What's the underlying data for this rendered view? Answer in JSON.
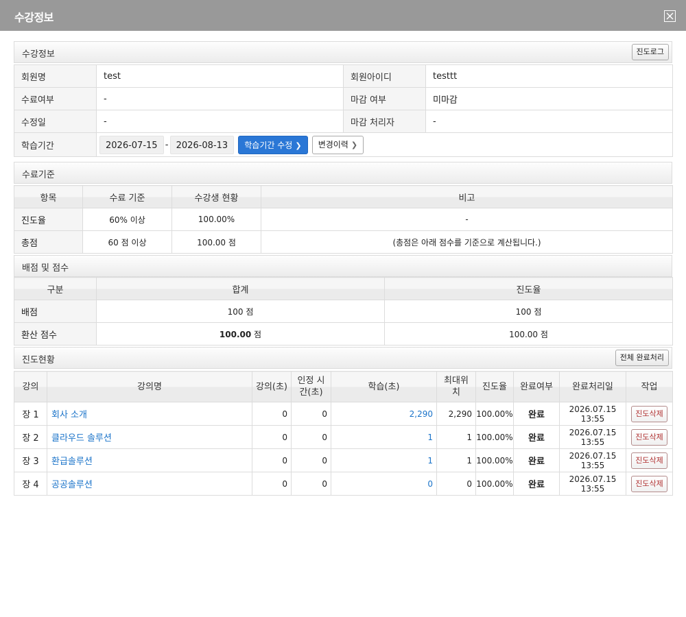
{
  "window": {
    "title": "수강정보"
  },
  "section_info": {
    "title": "수강정보",
    "log_button": "진도로그",
    "rows": {
      "member_name_label": "회원명",
      "member_name": "test",
      "member_id_label": "회원아이디",
      "member_id": "testtt",
      "completion_label": "수료여부",
      "completion": "-",
      "closing_label": "마감 여부",
      "closing": "미마감",
      "modified_label": "수정일",
      "modified": "-",
      "closer_label": "마감 처리자",
      "closer": "-",
      "period_label": "학습기간",
      "period_start": "2026-07-15",
      "period_sep": "-",
      "period_end": "2026-08-13",
      "edit_period_button": "학습기간 수정",
      "history_button": "변경이력"
    }
  },
  "section_criteria": {
    "title": "수료기준",
    "headers": [
      "항목",
      "수료 기준",
      "수강생 현황",
      "비고"
    ],
    "rows": [
      [
        "진도율",
        "60% 이상",
        "100.00%",
        "-"
      ],
      [
        "총점",
        "60 점 이상",
        "100.00 점",
        "(총점은 아래 점수를 기준으로 계산됩니다.)"
      ]
    ]
  },
  "section_scores": {
    "title": "배점 및 점수",
    "headers": [
      "구분",
      "합계",
      "진도율"
    ],
    "rows": [
      {
        "label": "배점",
        "total": "100 점",
        "progress": "100 점"
      },
      {
        "label": "환산 점수",
        "total_num": "100.00",
        "total_unit": " 점",
        "progress": "100.00 점"
      }
    ]
  },
  "section_progress": {
    "title": "진도현황",
    "complete_all_button": "전체 완료처리",
    "headers": [
      "강의",
      "강의명",
      "강의(초)",
      "인정 시간(초)",
      "학습(초)",
      "최대위치",
      "진도율",
      "완료여부",
      "완료처리일",
      "작업"
    ],
    "rows": [
      {
        "chapter": "장 1",
        "name": "회사 소개",
        "lecture_sec": "0",
        "recognized_sec": "0",
        "study_sec": "2,290",
        "max_pos": "2,290",
        "rate": "100.00%",
        "done": "완료",
        "done_date": "2026.07.15 13:55",
        "action": "진도삭제"
      },
      {
        "chapter": "장 2",
        "name": "클라우드 솔루션",
        "lecture_sec": "0",
        "recognized_sec": "0",
        "study_sec": "1",
        "max_pos": "1",
        "rate": "100.00%",
        "done": "완료",
        "done_date": "2026.07.15 13:55",
        "action": "진도삭제"
      },
      {
        "chapter": "장 3",
        "name": "환급솔루션",
        "lecture_sec": "0",
        "recognized_sec": "0",
        "study_sec": "1",
        "max_pos": "1",
        "rate": "100.00%",
        "done": "완료",
        "done_date": "2026.07.15 13:55",
        "action": "진도삭제"
      },
      {
        "chapter": "장 4",
        "name": "공공솔루션",
        "lecture_sec": "0",
        "recognized_sec": "0",
        "study_sec": "0",
        "max_pos": "0",
        "rate": "100.00%",
        "done": "완료",
        "done_date": "2026.07.15 13:55",
        "action": "진도삭제"
      }
    ]
  },
  "icons": {
    "close": "close-icon",
    "chevron": "chevron-right-icon"
  }
}
